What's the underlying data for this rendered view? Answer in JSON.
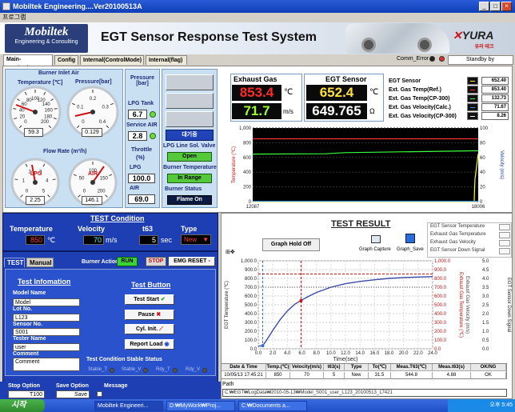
{
  "window": {
    "title": "Mobiltek Engineering....Ver20100513A",
    "min": "_",
    "max": "□",
    "close": "×"
  },
  "menu": {
    "program": "프로그램"
  },
  "header": {
    "logo_name": "Mobiltek",
    "logo_sub": "Engineering & Consulting",
    "title": "EGT Sensor Response Test System",
    "brand": "YURA",
    "brand_sub": "유라 테크"
  },
  "tabs": [
    "Main-Monitoring",
    "Config",
    "Internal(ControlMode)",
    "Internal(flag)"
  ],
  "status": {
    "comm_error": "Comm_Error",
    "standby": "Standby by"
  },
  "burner_inlet": {
    "title": "Burner Inlet Air",
    "temp_label": "Temperature [℃]",
    "temp_value": "59.3",
    "temp_ticks": [
      "0",
      "20",
      "40",
      "60",
      "80",
      "100",
      "120",
      "140",
      "160",
      "180",
      "200"
    ],
    "press_label": "Pressure[bar]",
    "press_value": "0.129",
    "press_ticks": [
      "0",
      "0.1",
      "0.2",
      "0.3",
      "0.4"
    ],
    "flow_title": "Flow Rate (m³/h)",
    "lpg_label": "LPG",
    "lpg_value": "2.25",
    "lpg_ticks": [
      "0",
      "1",
      "2",
      "3",
      "4",
      "5"
    ],
    "air_label": "AIR",
    "air_value": "146.1",
    "air_ticks": [
      "0",
      "50",
      "100",
      "150",
      "200"
    ]
  },
  "pressure": {
    "title": "Pressure\n[bar]",
    "lpg_tank_label": "LPG Tank",
    "lpg_tank_value": "6.7",
    "service_air_label": "Service AIR",
    "service_air_value": "2.8",
    "throttle_label": "Throttle",
    "throttle_unit": "(%)",
    "lpg_label": "LPG",
    "lpg_value": "100.0",
    "air_label": "AIR",
    "air_value": "69.0"
  },
  "controls": {
    "btn_blue": "대기중",
    "lpg_valve_label": "LPG Line Sol. Valve",
    "lpg_valve_value": "Open",
    "burner_temp_label": "Burner Temperature",
    "burner_temp_value": "In Range",
    "burner_status_label": "Burner Status",
    "burner_status_value": "Flame On"
  },
  "exhaust": {
    "title": "Exhaust Gas",
    "temp": "853.4",
    "temp_unit": "℃",
    "vel": "71.7",
    "vel_unit": "m/s"
  },
  "egt_sensor": {
    "title": "EGT Sensor",
    "temp": "652.4",
    "temp_unit": "℃",
    "res": "649.765",
    "res_unit": "Ω"
  },
  "sensor_list": [
    {
      "label": "EGT Sensor",
      "value": "652.40",
      "color": "#ffff00"
    },
    {
      "label": "Ext. Gas Temp(Ref.)",
      "value": "853.40",
      "color": "#ff3030"
    },
    {
      "label": "Ext. Gas Temp(CP-300)",
      "value": "132.73",
      "color": "#3aff3a"
    },
    {
      "label": "Ext. Gas Velocity(Calc.)",
      "value": "71.67",
      "color": "#3a8aff"
    },
    {
      "label": "Ext. Gas Velocity(CP-300)",
      "value": "8.26",
      "color": "#ffffff"
    }
  ],
  "trend": {
    "ylabel_left": "Temperature (℃)",
    "ylabel_right": "Velocity (m/s)",
    "y_left": [
      "1,000",
      "800",
      "600",
      "400",
      "200",
      "0"
    ],
    "y_right": [
      "100",
      "80",
      "60",
      "40",
      "20",
      "0"
    ],
    "x_start": "12087",
    "x_end": "18006"
  },
  "test_condition": {
    "title": "TEST Condition",
    "temp_label": "Temperature",
    "temp_value": "850",
    "temp_unit": "℃",
    "vel_label": "Velocity",
    "vel_value": "70",
    "vel_unit": "m/s",
    "t63_label": "t63",
    "t63_value": "5",
    "t63_unit": "sec",
    "type_label": "Type",
    "type_value": "New"
  },
  "test_tabs": [
    "TEST",
    "Manual"
  ],
  "burner_action": {
    "label": "Burner Action",
    "run": "RUN",
    "stop": "STOP",
    "emg": "EMG RESET"
  },
  "test_info": {
    "title": "Test Infomation",
    "model_label": "Model Name",
    "model_value": "Model",
    "lot_label": "Lot No.",
    "lot_value": "L123",
    "sensor_label": "Sensor No.",
    "sensor_value": "S001",
    "tester_label": "Tester Name",
    "tester_value": "user",
    "comment_label": "Comment",
    "comment_value": "Comment"
  },
  "test_buttons": {
    "title": "Test Button",
    "start": "Test Start",
    "pause": "Pause",
    "cyl": "Cyl. Init.",
    "report": "Report Load"
  },
  "stable": {
    "title": "Test Condition Stable Status",
    "items": [
      "Stable_T",
      "Stable_V",
      "Rdy_T",
      "Rdy_V"
    ]
  },
  "bottom_opts": {
    "stop_label": "Stop Option",
    "stop_value": "T100",
    "save_label": "Save Option",
    "save_value": "Save",
    "message_label": "Message"
  },
  "result": {
    "title": "TEST RESULT",
    "graph_hold": "Graph Hold Off",
    "capture": "Graph Capture",
    "save": "Graph_Save",
    "legend": [
      "EGT Sensor Temperature",
      "Exhaust Gas Temperature",
      "Exhaust Gas Velocity",
      "EGT Sensor Down Signal"
    ],
    "y_left": [
      "1,000.0",
      "900.0",
      "800.0",
      "700.0",
      "600.0",
      "500.0",
      "400.0",
      "300.0",
      "200.0",
      "100.0",
      "0.0"
    ],
    "y_right": [
      "1,000.0",
      "900.0",
      "800.0",
      "700.0",
      "600.0",
      "500.0",
      "400.0",
      "300.0",
      "200.0",
      "100.0",
      "0.0"
    ],
    "y_right2": [
      "5.0",
      "4.5",
      "4.0",
      "3.5",
      "3.0",
      "2.5",
      "2.0",
      "1.5",
      "1.0",
      "0.5",
      "0.0"
    ],
    "ylabel_left": "EGT Temperature (℃)",
    "ylabel_mid": "Exhaust Gas Temperature (℃)",
    "ylabel_mid2": "Exhaust Gas Velocity (m/s)",
    "ylabel_right": "EGT Sensor Down Signal",
    "x": [
      "0.0",
      "2.0",
      "4.0",
      "6.0",
      "8.0",
      "10.0",
      "12.0",
      "14.0",
      "16.0",
      "18.0",
      "20.0",
      "22.0",
      "24.0"
    ],
    "xlabel": "Time(sec)"
  },
  "result_table": {
    "headers": [
      "Date & Time",
      "Temp.(℃)",
      "Velocity(m/s)",
      "t63(s)",
      "Type",
      "To(℃)",
      "Meas.T63(℃)",
      "Meas.t63(s)",
      "OK/NG"
    ],
    "row": [
      "10/05/13 17:45:21",
      "850",
      "70",
      "5",
      "New",
      "31.5",
      "544.8",
      "4.88",
      "OK"
    ]
  },
  "path": {
    "label": "Path",
    "value": "C:₩EGT₩LogData₩2010-05-13₩Model_S001_user_L123_20100513_17421"
  },
  "taskbar": {
    "start": "시작",
    "tasks": [
      "Mobiltek Engineeri...",
      "D:₩MyWork₩Proj...",
      "C:₩Documents a..."
    ],
    "clock": "오후 5:45"
  },
  "chart_data": [
    {
      "type": "line",
      "title": "",
      "xlabel": "",
      "ylabel": "Temperature (℃)",
      "y2label": "Velocity (m/s)",
      "xlim": [
        12087,
        18006
      ],
      "ylim": [
        0,
        1000
      ],
      "y2lim": [
        0,
        100
      ],
      "series": [
        {
          "name": "Ext. Gas Temp(Ref.)",
          "color": "#ff3030",
          "x": [
            12087,
            18006
          ],
          "y": [
            853,
            853
          ]
        },
        {
          "name": "Ext. Gas Temp(CP-300)",
          "color": "#3aff3a",
          "x": [
            12087,
            14000,
            14500,
            17900,
            18006
          ],
          "y": [
            645,
            650,
            665,
            690,
            690
          ]
        },
        {
          "name": "EGT Sensor",
          "color": "#ffff00",
          "x": [
            12087,
            17900,
            17920,
            18006
          ],
          "y": [
            0,
            0,
            300,
            652
          ]
        },
        {
          "name": "Ext. Gas Velocity(Calc.)",
          "color": "#3a8aff",
          "x": [
            12087,
            18006
          ],
          "y": [
            5,
            5
          ]
        }
      ]
    },
    {
      "type": "line",
      "title": "TEST RESULT",
      "xlabel": "Time(sec)",
      "ylabel": "EGT Temperature (℃)",
      "xlim": [
        0,
        24
      ],
      "ylim": [
        0,
        1000
      ],
      "series": [
        {
          "name": "EGT Sensor Temperature",
          "x": [
            0,
            0.6,
            1,
            2,
            3,
            4,
            5,
            6,
            7,
            8,
            10,
            12,
            14,
            16,
            18,
            20,
            22,
            24
          ],
          "y": [
            30,
            35,
            80,
            210,
            330,
            430,
            505,
            555,
            600,
            640,
            700,
            740,
            765,
            785,
            800,
            810,
            815,
            820
          ]
        },
        {
          "name": "Exhaust Gas Temperature",
          "x": [
            0,
            24
          ],
          "y": [
            850,
            850
          ]
        },
        {
          "name": "Exhaust Gas Velocity",
          "x": [
            0,
            24
          ],
          "y": [
            700,
            700
          ]
        }
      ]
    }
  ]
}
